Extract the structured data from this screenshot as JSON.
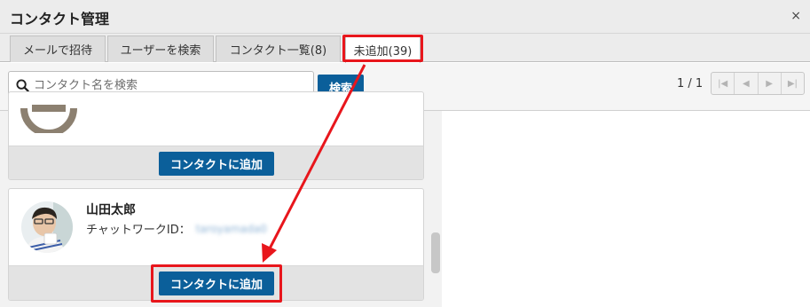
{
  "window": {
    "title": "コンタクト管理",
    "close_label": "×"
  },
  "tabs": [
    {
      "label": "メールで招待",
      "active": false
    },
    {
      "label": "ユーザーを検索",
      "active": false
    },
    {
      "label": "コンタクト一覧(8)",
      "active": false
    },
    {
      "label": "未追加(39)",
      "active": true
    }
  ],
  "search": {
    "placeholder": "コンタクト名を検索",
    "value": "",
    "button_label": "検索"
  },
  "pager": {
    "text": "1 / 1",
    "first": "|◀",
    "prev": "◀",
    "next": "▶",
    "last": "▶|"
  },
  "contacts": [
    {
      "add_label": "コンタクトに追加"
    },
    {
      "name": "山田太郎",
      "cw_label": "チャットワークID：",
      "cw_value": "taroyamada0",
      "add_label": "コンタクトに追加"
    }
  ],
  "colors": {
    "accent": "#0b5f9a",
    "highlight": "#e8161c"
  }
}
